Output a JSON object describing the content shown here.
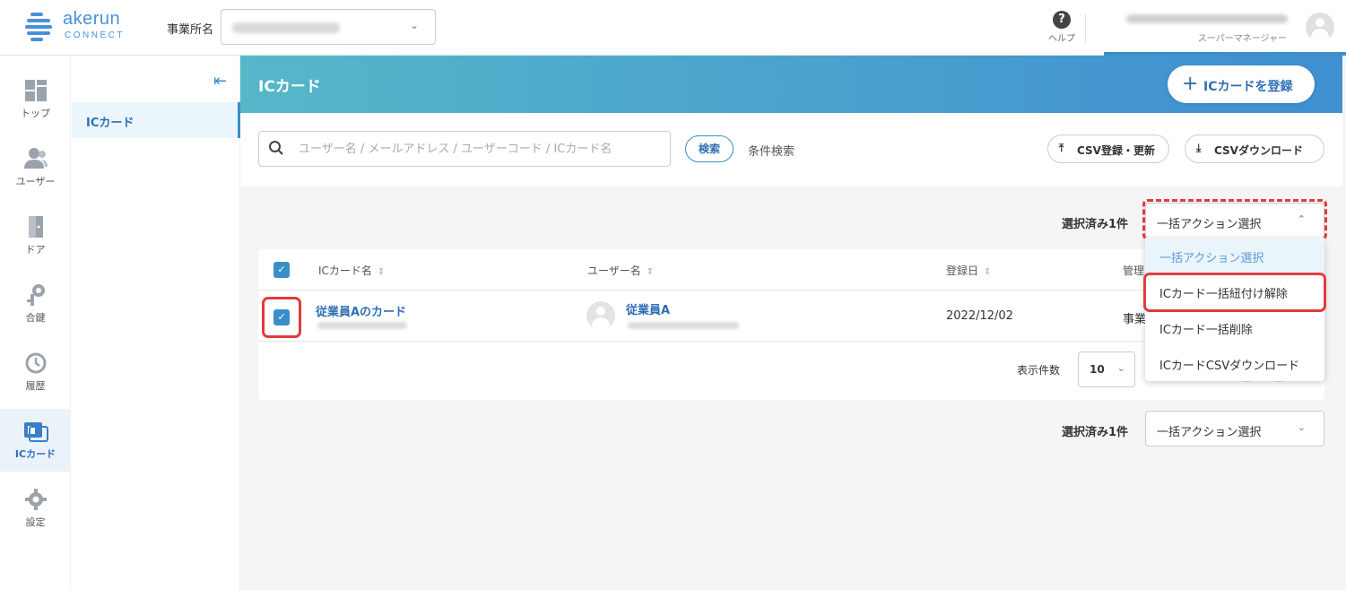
{
  "header": {
    "logo_text": "akerun",
    "logo_sub": "CONNECT",
    "office_label": "事業所名",
    "help_label": "ヘルプ",
    "user_role": "スーパーマネージャー"
  },
  "leftnav": {
    "items": [
      {
        "label": "トップ",
        "icon": "dashboard-icon"
      },
      {
        "label": "ユーザー",
        "icon": "users-icon"
      },
      {
        "label": "ドア",
        "icon": "door-icon"
      },
      {
        "label": "合鍵",
        "icon": "key-icon"
      },
      {
        "label": "履歴",
        "icon": "history-icon"
      },
      {
        "label": "ICカード",
        "icon": "ic-card-icon"
      },
      {
        "label": "設定",
        "icon": "settings-icon"
      }
    ],
    "active_index": 5
  },
  "subnav": {
    "active_item": "ICカード"
  },
  "page": {
    "title": "ICカード",
    "register_button": "ICカードを登録",
    "search_placeholder": "ユーザー名 / メールアドレス / ユーザーコード / ICカード名",
    "search_button": "検索",
    "condition_search": "条件検索",
    "csv_upload": "CSV登録・更新",
    "csv_download": "CSVダウンロード",
    "selected_count": "選択済み1件",
    "bulk_action_placeholder": "一括アクション選択"
  },
  "table": {
    "columns": [
      "ICカード名",
      "ユーザー名",
      "登録日",
      "管理"
    ],
    "rows": [
      {
        "card_name": "従業員Aのカード",
        "user_name": "従業員A",
        "registered": "2022/12/02",
        "mgmt": "事業",
        "checked": true
      }
    ],
    "per_page_label": "表示件数",
    "per_page_value": "10"
  },
  "dropdown": {
    "items": [
      "一括アクション選択",
      "ICカード一括紐付け解除",
      "ICカード一括削除",
      "ICカードCSVダウンロード"
    ],
    "highlighted_index": 1
  },
  "colors": {
    "accent": "#3a8fc9",
    "highlight": "#e03c3c",
    "banner_start": "#56b7c9",
    "banner_end": "#3f8fd1"
  }
}
